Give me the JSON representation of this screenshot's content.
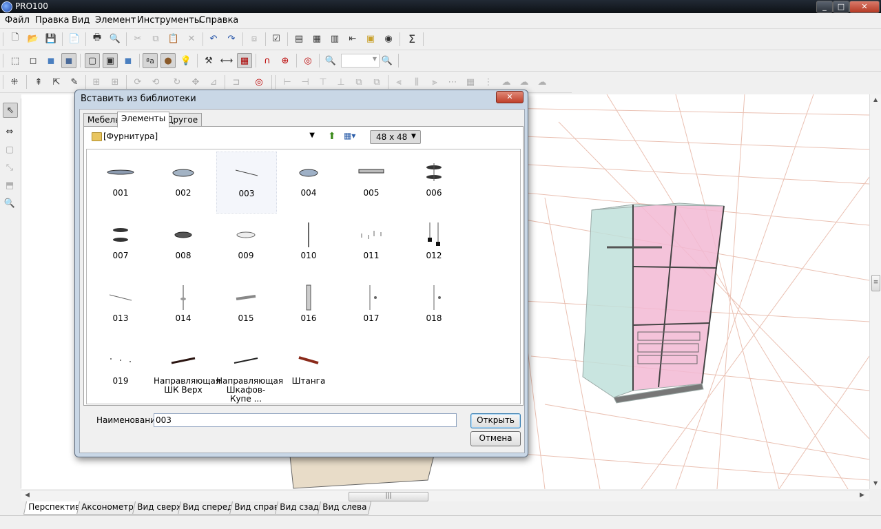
{
  "window": {
    "title": "PRO100",
    "minimize": "_",
    "maximize": "□",
    "close": "✕"
  },
  "menu": [
    "Файл",
    "Правка",
    "Вид",
    "Элемент",
    "Инструменты",
    "Справка"
  ],
  "toolbar": {
    "sum_glyph": "Σ"
  },
  "view_tabs": [
    "Перспектива",
    "Аксонометрия",
    "Вид сверху",
    "Вид спереди",
    "Вид справа",
    "Вид сзади",
    "Вид слева"
  ],
  "view_tabs_active": "Перспектива",
  "hscroll_grip": "|||",
  "vscroll_grip": "≡",
  "dialog": {
    "title": "Вставить из библиотеки",
    "close": "✕",
    "tabs": [
      "Мебель",
      "Элементы",
      "Другое"
    ],
    "active_tab": "Элементы",
    "path": "[Фурнитура]",
    "icon_size": "48 x  48",
    "items": [
      "001",
      "002",
      "003",
      "004",
      "005",
      "006",
      "007",
      "008",
      "009",
      "010",
      "011",
      "012",
      "013",
      "014",
      "015",
      "016",
      "017",
      "018",
      "019",
      "Направляющая ШК Верх",
      "Направляющая Шкафов-Купе ...",
      "Штанга"
    ],
    "selected_item": "003",
    "name_label": "Наименование",
    "name_value": "003",
    "open_button": "Открыть",
    "cancel_button": "Отмена"
  },
  "colors": {
    "accent_pink": "#f2b8d4",
    "cabinet_glass": "#bfe0da",
    "grid_lines": "#e8b8a8"
  }
}
